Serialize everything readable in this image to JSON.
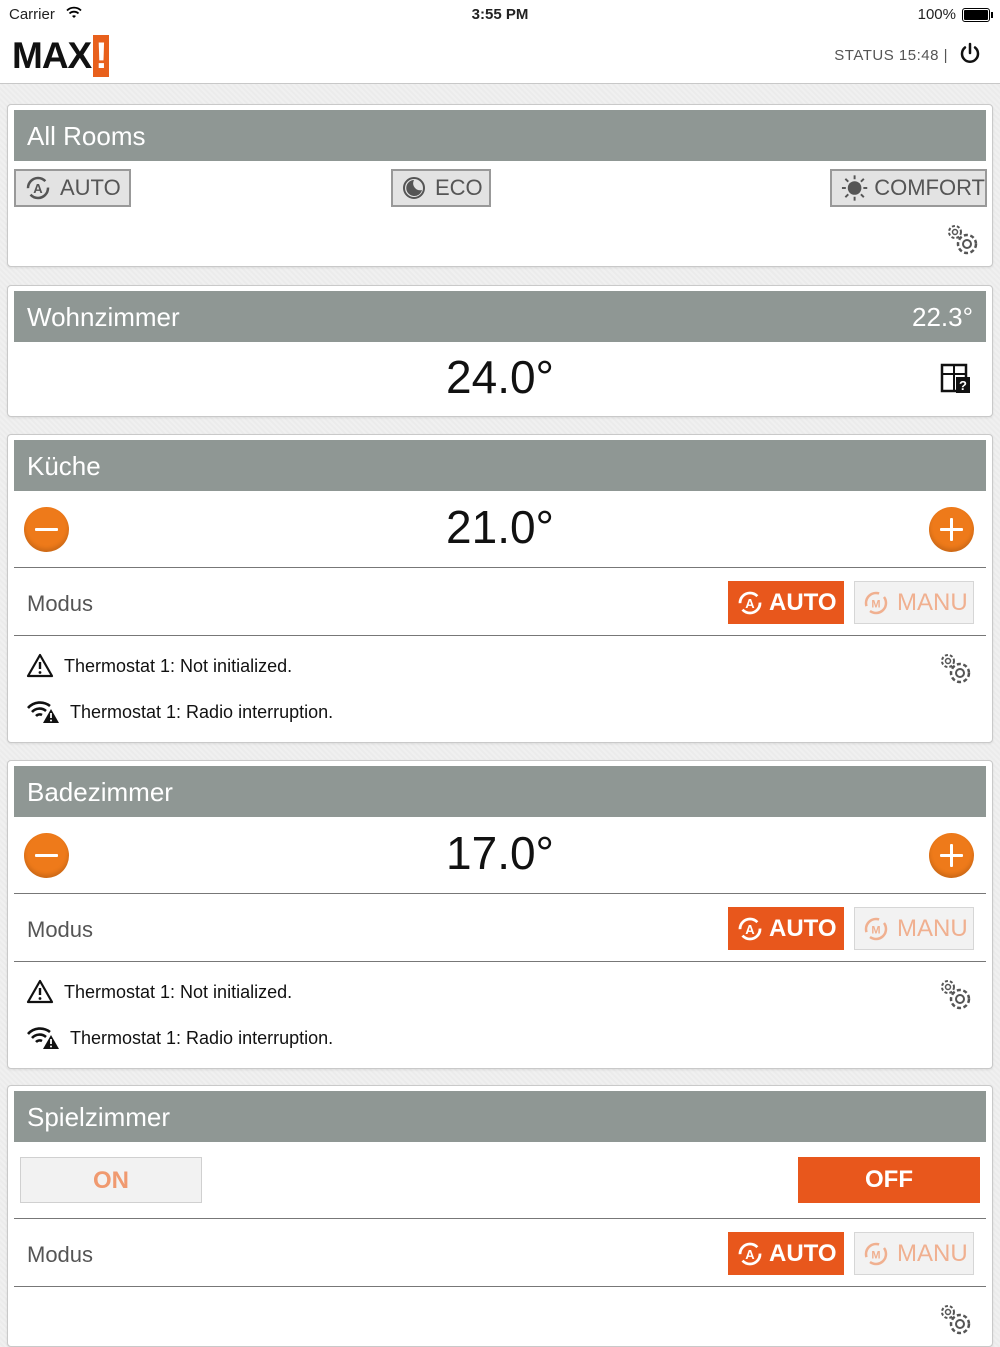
{
  "statusbar": {
    "carrier": "Carrier",
    "time": "3:55 PM",
    "battery": "100%"
  },
  "header": {
    "logo": "MAX",
    "logo_mark": "!",
    "status": "STATUS 15:48 |"
  },
  "all_rooms": {
    "title": "All Rooms",
    "buttons": {
      "auto": "AUTO",
      "eco": "ECO",
      "comfort": "COMFORT"
    }
  },
  "rooms": [
    {
      "name": "Wohnzimmer",
      "current_temp": "22.3°",
      "setpoint": "24.0°"
    },
    {
      "name": "Küche",
      "setpoint": "21.0°",
      "modus_label": "Modus",
      "mode_auto": "AUTO",
      "mode_manu": "MANU",
      "messages": [
        "Thermostat 1: Not initialized.",
        "Thermostat 1: Radio interruption."
      ]
    },
    {
      "name": "Badezimmer",
      "setpoint": "17.0°",
      "modus_label": "Modus",
      "mode_auto": "AUTO",
      "mode_manu": "MANU",
      "messages": [
        "Thermostat 1: Not initialized.",
        "Thermostat 1: Radio interruption."
      ]
    },
    {
      "name": "Spielzimmer",
      "on_label": "ON",
      "off_label": "OFF",
      "modus_label": "Modus",
      "mode_auto": "AUTO",
      "mode_manu": "MANU"
    }
  ],
  "colors": {
    "accent": "#e8571c",
    "plus_minus": "#ee7a1a",
    "room_header": "#8f9794"
  },
  "icons": [
    "wifi-icon",
    "battery-icon",
    "power-icon",
    "auto-mode-icon",
    "eco-moon-icon",
    "comfort-sun-icon",
    "gear-icon",
    "window-status-icon",
    "minus-icon",
    "plus-icon",
    "manual-mode-icon",
    "warning-icon",
    "radio-warning-icon"
  ]
}
